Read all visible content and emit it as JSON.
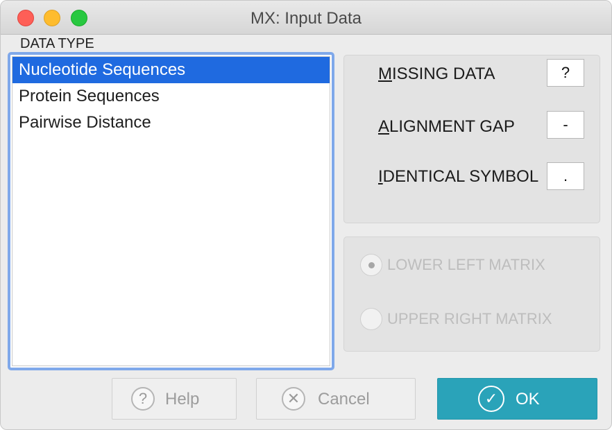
{
  "window": {
    "title": "MX: Input Data"
  },
  "data_type": {
    "label": "DATA TYPE",
    "items": [
      {
        "label": "Nucleotide Sequences",
        "selected": true
      },
      {
        "label": "Protein Sequences",
        "selected": false
      },
      {
        "label": "Pairwise Distance",
        "selected": false
      }
    ]
  },
  "symbols": {
    "missing_data": {
      "mnemonic": "M",
      "label_rest": "ISSING DATA",
      "value": "?"
    },
    "alignment_gap": {
      "mnemonic": "A",
      "label_rest": "LIGNMENT GAP",
      "value": "-"
    },
    "identical_symbol": {
      "mnemonic": "I",
      "label_rest": "DENTICAL SYMBOL",
      "value": "."
    }
  },
  "matrix": {
    "lower_left": {
      "label": "LOWER LEFT MATRIX",
      "checked": true,
      "enabled": false
    },
    "upper_right": {
      "label": "UPPER RIGHT MATRIX",
      "checked": false,
      "enabled": false
    }
  },
  "buttons": {
    "help": {
      "label": "Help",
      "icon": "?"
    },
    "cancel": {
      "label": "Cancel",
      "icon": "✕"
    },
    "ok": {
      "label": "OK",
      "icon": "✓"
    }
  },
  "colors": {
    "selection": "#1f6ae0",
    "ok_button": "#2aa3b9",
    "focus_ring": "#7fa8ea"
  }
}
